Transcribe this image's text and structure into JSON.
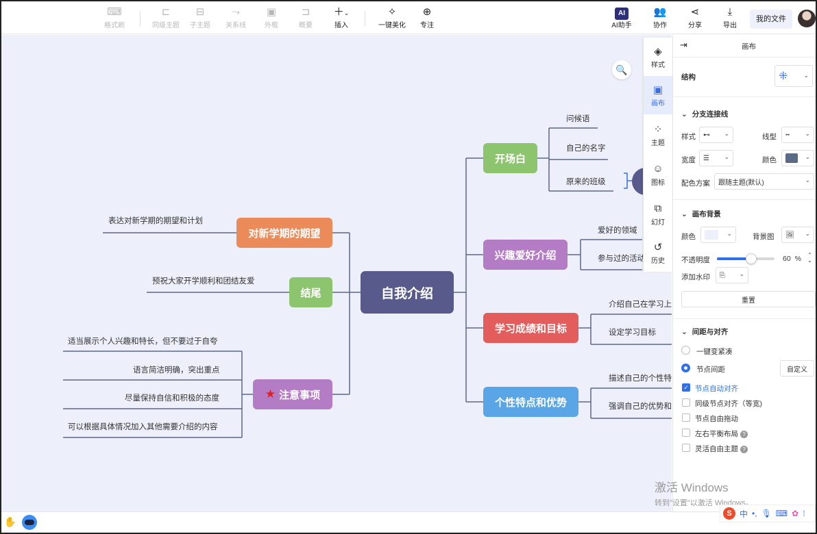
{
  "toolbar": {
    "items": [
      {
        "label": "格式刷",
        "icon": "format-painter-icon"
      },
      {
        "label": "同级主题",
        "icon": "sibling-topic-icon"
      },
      {
        "label": "子主题",
        "icon": "child-topic-icon"
      },
      {
        "label": "关系线",
        "icon": "relation-line-icon"
      },
      {
        "label": "外框",
        "icon": "boundary-icon"
      },
      {
        "label": "概要",
        "icon": "summary-icon"
      },
      {
        "label": "插入",
        "icon": "plus-icon"
      },
      {
        "label": "一键美化",
        "icon": "magic-wand-icon"
      },
      {
        "label": "专注",
        "icon": "focus-icon"
      },
      {
        "label": "AI助手",
        "icon": "ai-icon"
      },
      {
        "label": "协作",
        "icon": "collaborate-icon"
      },
      {
        "label": "分享",
        "icon": "share-icon"
      },
      {
        "label": "导出",
        "icon": "export-icon"
      }
    ],
    "ai_badge": "AI",
    "my_files": "我的文件"
  },
  "mindmap": {
    "root": "自我介绍",
    "right_branches": [
      {
        "label": "开场白",
        "color": "#8dc46e",
        "children": [
          "问候语",
          "自己的名字",
          "原来的班级"
        ]
      },
      {
        "label": "兴趣爱好介绍",
        "color": "#b57cc6",
        "children": [
          "爱好的领域",
          "参与过的活动"
        ]
      },
      {
        "label": "学习成绩和目标",
        "color": "#e35d5d",
        "children": [
          "介绍自己在学习上",
          "设定学习目标"
        ]
      },
      {
        "label": "个性特点和优势",
        "color": "#5aa5e6",
        "children": [
          "描述自己的个性特",
          "强调自己的优势和"
        ]
      }
    ],
    "left_branches": [
      {
        "label": "对新学期的期望",
        "color": "#ec8b5a",
        "children": [
          "表达对新学期的期望和计划"
        ]
      },
      {
        "label": "结尾",
        "color": "#8dc46e",
        "children": [
          "预祝大家开学顺利和团结友爱"
        ]
      },
      {
        "label": "注意事项",
        "color": "#b57cc6",
        "icon": "star-icon",
        "children": [
          "适当展示个人兴趣和特长，但不要过于自夸",
          "语言简洁明确，突出重点",
          "尽量保持自信和积极的态度",
          "可以根据具体情况加入其他需要介绍的内容"
        ]
      }
    ],
    "root_color": "#575a8a"
  },
  "side_tabs": [
    {
      "label": "样式",
      "icon": "style-icon"
    },
    {
      "label": "画布",
      "icon": "canvas-icon",
      "active": true
    },
    {
      "label": "主题",
      "icon": "theme-icon"
    },
    {
      "label": "图标",
      "icon": "emoji-icon"
    },
    {
      "label": "幻灯",
      "icon": "slides-icon"
    },
    {
      "label": "历史",
      "icon": "history-icon"
    }
  ],
  "panel": {
    "title": "画布",
    "structure_label": "结构",
    "branch_section": "分支连接线",
    "style_label": "样式",
    "line_type_label": "线型",
    "width_label": "宽度",
    "color_label": "颜色",
    "line_color": "#5b6a85",
    "scheme_label": "配色方案",
    "scheme_value": "跟随主题(默认)",
    "bg_section": "画布背景",
    "bg_color_label": "颜色",
    "bg_color": "#edf0fb",
    "bg_image_label": "背景图",
    "opacity_label": "不透明度",
    "opacity_value": "60",
    "opacity_unit": "%",
    "opacity_fraction": 0.6,
    "watermark_label": "添加水印",
    "reset_button": "重置",
    "spacing_section": "间距与对齐",
    "radio_compact": "一键变紧凑",
    "radio_spacing": "节点间距",
    "custom_button": "自定义",
    "checks": [
      {
        "label": "节点自动对齐",
        "checked": true,
        "help": false
      },
      {
        "label": "同级节点对齐（等宽)",
        "checked": false,
        "help": false
      },
      {
        "label": "节点自由拖动",
        "checked": false,
        "help": false
      },
      {
        "label": "左右平衡布局",
        "checked": false,
        "help": true
      },
      {
        "label": "灵活自由主题",
        "checked": false,
        "help": true
      }
    ]
  },
  "watermark": {
    "line1": "激活 Windows",
    "line2": "转到\"设置\"以激活 Windows。"
  },
  "ime": {
    "lang": "中"
  }
}
